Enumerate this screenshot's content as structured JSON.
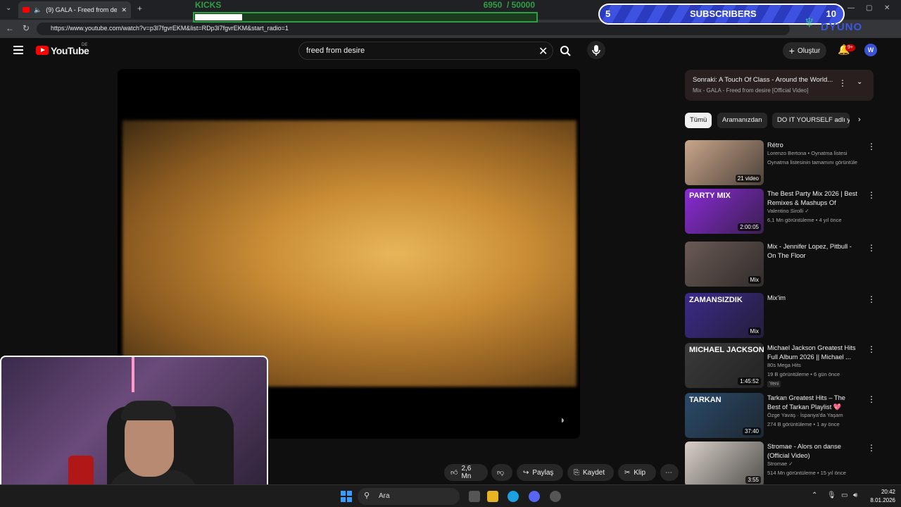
{
  "browser": {
    "tab_title": "(9) GALA - Freed from desire [",
    "url": "https://www.youtube.com/watch?v=p3l7fgvrEKM&list=RDp3l7fgvrEKM&start_radio=1"
  },
  "overlay": {
    "kicks_label": "KICKS",
    "kicks_count": "6950",
    "kicks_goal": "/ 50000",
    "kicks_progress": 0.139,
    "subs_left": "5",
    "subs_label": "SUBSCRIBERS",
    "subs_right": "10",
    "logo_text": "DYUNO"
  },
  "header": {
    "logo_text": "YouTube",
    "region": "DE",
    "search_value": "freed from desire",
    "create_label": "Oluştur",
    "notif_count": "9+",
    "avatar_letter": "W"
  },
  "actions": {
    "like_count": "2,6 Mn",
    "share_label": "Paylaş",
    "save_label": "Kaydet",
    "clip_label": "Klip"
  },
  "sidebar": {
    "next_title": "Sonraki: A Touch Of Class - Around the World...",
    "next_sub": "Mix - GALA - Freed from desire [Official Video]",
    "chips": [
      "Tümü",
      "Aramanızdan",
      "DO IT YOURSELF adlı y..."
    ],
    "videos": [
      {
        "title": "Rétro",
        "meta1": "Lorenzo Bertona • Oynatma listesi",
        "meta2": "Oynatma listesinin tamamını görüntüle",
        "overlay": "21 video",
        "thumb": "#c9a58a"
      },
      {
        "title": "The Best Party Mix 2026 | Best Remixes & Mashups Of Popul...",
        "meta1": "Valentino Sirolli ✓",
        "meta2": "6,1 Mn görüntüleme • 4 yıl önce",
        "overlay": "2:00:05",
        "thumb": "#8a2bd6",
        "thumb_text": "PARTY MIX"
      },
      {
        "title": "Mix - Jennifer Lopez, Pitbull - On The Floor",
        "meta1": "",
        "meta2": "",
        "overlay": "Mix",
        "thumb": "#6a5a55"
      },
      {
        "title": "Mix'im",
        "meta1": "",
        "meta2": "",
        "overlay": "Mix",
        "thumb": "#3c2a8a",
        "thumb_text": "ZAMANSIZDIK"
      },
      {
        "title": "Michael Jackson Greatest Hits Full Album 2026 || Michael ...",
        "meta1": "80s Mega Hits",
        "meta2": "19 B görüntüleme • 6 gün önce",
        "overlay": "1:45:52",
        "thumb": "#3a3a3a",
        "thumb_text": "MICHAEL JACKSON",
        "new_badge": "Yeni"
      },
      {
        "title": "Tarkan Greatest Hits – The Best of Tarkan Playlist 💖",
        "meta1": "Özge Yavaş · İspanya'da Yaşam",
        "meta2": "274 B görüntüleme • 1 ay önce",
        "overlay": "37:40",
        "thumb": "#2a4a6a",
        "thumb_text": "TARKAN"
      },
      {
        "title": "Stromae - Alors on danse (Official Video)",
        "meta1": "Stromae ✓",
        "meta2": "514 Mn görüntüleme • 15 yıl önce",
        "overlay": "3:55",
        "thumb": "#d8d0c8"
      }
    ]
  },
  "taskbar": {
    "search_label": "Ara",
    "time": "20:42",
    "date": "8.01.2026"
  },
  "colors": {
    "kick_green": "#2ea043",
    "yt_red": "#ff0000",
    "subs_blue": "#3d52e0"
  }
}
